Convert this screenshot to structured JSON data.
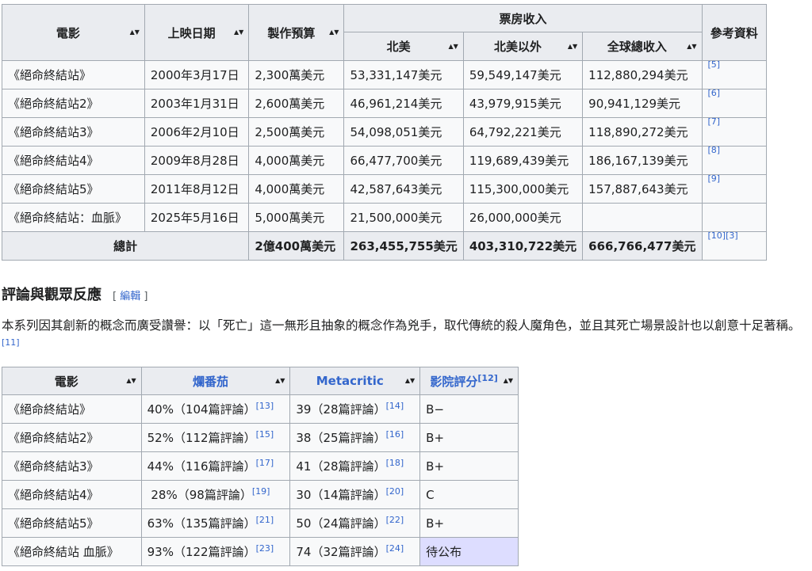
{
  "box_office_table": {
    "headers": {
      "film": "電影",
      "release": "上映日期",
      "budget": "製作預算",
      "box_office": "票房收入",
      "references": "參考資料",
      "north_america": "北美",
      "outside_na": "北美以外",
      "worldwide": "全球總收入"
    },
    "rows": [
      {
        "film": "《絕命終結站》",
        "release": "2000年3月17日",
        "budget": "2,300萬美元",
        "na": "53,331,147美元",
        "outside": "59,549,147美元",
        "world": "112,880,294美元",
        "ref": "[5]"
      },
      {
        "film": "《絕命終結站2》",
        "release": "2003年1月31日",
        "budget": "2,600萬美元",
        "na": "46,961,214美元",
        "outside": "43,979,915美元",
        "world": "90,941,129美元",
        "ref": "[6]"
      },
      {
        "film": "《絕命終結站3》",
        "release": "2006年2月10日",
        "budget": "2,500萬美元",
        "na": "54,098,051美元",
        "outside": "64,792,221美元",
        "world": "118,890,272美元",
        "ref": "[7]"
      },
      {
        "film": "《絕命終結站4》",
        "release": "2009年8月28日",
        "budget": "4,000萬美元",
        "na": "66,477,700美元",
        "outside": "119,689,439美元",
        "world": "186,167,139美元",
        "ref": "[8]"
      },
      {
        "film": "《絕命終結站5》",
        "release": "2011年8月12日",
        "budget": "4,000萬美元",
        "na": "42,587,643美元",
        "outside": "115,300,000美元",
        "world": "157,887,643美元",
        "ref": "[9]"
      },
      {
        "film": "《絕命終結站：血脈》",
        "release": "2025年5月16日",
        "budget": "5,000萬美元",
        "na": "21,500,000美元",
        "outside": "26,000,000美元",
        "world": "",
        "ref": ""
      }
    ],
    "total": {
      "label": "總計",
      "budget": "2億400萬美元",
      "na": "263,455,755美元",
      "outside": "403,310,722美元",
      "world": "666,766,477美元",
      "ref": "[10][3]"
    }
  },
  "section": {
    "heading": "評論與觀眾反應",
    "edit_open": "[ ",
    "edit_label": "編輯",
    "edit_close": " ]",
    "paragraph": "本系列因其創新的概念而廣受讚譽：以「死亡」這一無形且抽象的概念作為兇手，取代傳統的殺人魔角色，並且其死亡場景設計也以創意十足著稱。",
    "paragraph_ref": "[11]"
  },
  "reception_table": {
    "headers": {
      "film": "電影",
      "rt": "爛番茄",
      "mc": "Metacritic",
      "cs": "影院評分",
      "cs_ref": "[12]"
    },
    "rows": [
      {
        "film": "《絕命終結站》",
        "rt": "40%（104篇評論）",
        "rt_ref": "[13]",
        "mc": "39（28篇評論）",
        "mc_ref": "[14]",
        "cs": "B−"
      },
      {
        "film": "《絕命終結站2》",
        "rt": "52%（112篇評論）",
        "rt_ref": "[15]",
        "mc": "38（25篇評論）",
        "mc_ref": "[16]",
        "cs": "B+"
      },
      {
        "film": "《絕命終結站3》",
        "rt": "44%（116篇評論）",
        "rt_ref": "[17]",
        "mc": "41（28篇評論）",
        "mc_ref": "[18]",
        "cs": "B+"
      },
      {
        "film": "《絕命終結站4》",
        "rt": " 28%（98篇評論）",
        "rt_ref": "[19]",
        "mc": "30（14篇評論）",
        "mc_ref": "[20]",
        "cs": "C"
      },
      {
        "film": "《絕命終結站5》",
        "rt": "63%（135篇評論）",
        "rt_ref": "[21]",
        "mc": "50（24篇評論）",
        "mc_ref": "[22]",
        "cs": "B+"
      },
      {
        "film": "《絕命終結站 血脈》",
        "rt": "93%（122篇評論）",
        "rt_ref": "[23]",
        "mc": "74（32篇評論）",
        "mc_ref": "[24]",
        "cs": "待公布",
        "cs_tba": true
      }
    ]
  },
  "colors": {
    "link": "#3366cc",
    "header_bg": "#eaecf0",
    "table_bg": "#f8f9fa",
    "border": "#a2a9b1",
    "tba_bg": "#ddddff"
  },
  "icons": {
    "sort": "sort-arrows-icon"
  }
}
